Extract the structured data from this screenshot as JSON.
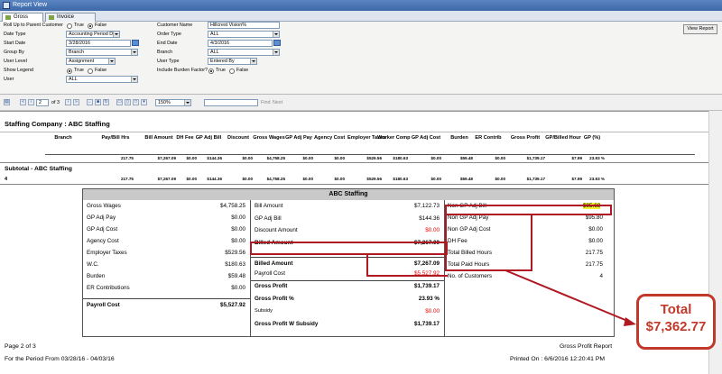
{
  "window": {
    "title": "Report View"
  },
  "tabs": [
    {
      "label": "Gross Profit"
    },
    {
      "label": "Invoice Register"
    }
  ],
  "filters": {
    "rollup_label": "Roll Up to Parent Customer",
    "rollup_true": "True",
    "rollup_false": "False",
    "date_type_label": "Date Type",
    "date_type_value": "Accounting Period Date",
    "start_date_label": "Start Date",
    "start_date_value": "3/28/2016",
    "group_by_label": "Group By",
    "group_by_value": "Branch",
    "user_level_label": "User Level",
    "user_level_value": "Assignment",
    "show_legend_label": "Show Legend",
    "show_legend_true": "True",
    "show_legend_false": "False",
    "user_label": "User",
    "user_value": "ALL",
    "customer_name_label": "Customer Name",
    "customer_name_value": "Hillcrest Vision%",
    "order_type_label": "Order Type",
    "order_type_value": "ALL",
    "end_date_label": "End Date",
    "end_date_value": "4/3/2016",
    "branch_label": "Branch",
    "branch_value": "ALL",
    "user_type_label": "User Type",
    "user_type_value": "Entered By",
    "burden_label": "Include Burden Factor?",
    "burden_true": "True",
    "burden_false": "False",
    "view_report": "View Report"
  },
  "toolbar": {
    "page_input": "2",
    "page_of": "of 3",
    "zoom": "150%",
    "find_label": "Find",
    "next_label": "Next"
  },
  "report": {
    "company_title": "Staffing Company : ABC Staffing",
    "columns": [
      "Branch",
      "Pay/Bill Hrs",
      "Bill Amount",
      "DH Fee",
      "GP Adj Bill",
      "Discount",
      "Gross Wages",
      "GP Adj Pay",
      "Agency Cost",
      "Employer Taxes",
      "Worker Comp",
      "GP Adj Cost",
      "Burden",
      "ER Contrib",
      "Gross Profit",
      "GP/Billed Hour",
      "GP (%)"
    ],
    "detail_row": [
      "",
      "217.75",
      "$7,267.09",
      "$0.00",
      "$144.36",
      "$0.00",
      "$4,758.25",
      "$0.00",
      "$0.00",
      "$529.56",
      "$180.63",
      "$0.00",
      "$59.48",
      "$0.00",
      "$1,739.17",
      "$7.99",
      "23.93 %"
    ],
    "subtotal_label": "Subtotal - ABC Staffing",
    "subtotal_index": "4",
    "subtotal_row": [
      "",
      "217.75",
      "$7,267.09",
      "$0.00",
      "$144.36",
      "$0.00",
      "$4,758.25",
      "$0.00",
      "$0.00",
      "$529.56",
      "$180.63",
      "$0.00",
      "$59.48",
      "$0.00",
      "$1,739.17",
      "$7.99",
      "23.93 %"
    ]
  },
  "summary": {
    "title": "ABC Staffing",
    "col1": [
      {
        "label": "Gross Wages",
        "value": "$4,758.25"
      },
      {
        "label": "GP Adj Pay",
        "value": "$0.00"
      },
      {
        "label": "GP Adj Cost",
        "value": "$0.00"
      },
      {
        "label": "Agency Cost",
        "value": "$0.00"
      },
      {
        "label": "Employer Taxes",
        "value": "$529.56"
      },
      {
        "label": "W.C.",
        "value": "$180.63"
      },
      {
        "label": "Burden",
        "value": "$59.48"
      },
      {
        "label": "ER Contributions",
        "value": "$0.00"
      }
    ],
    "payroll_cost_label": "Payroll Cost",
    "payroll_cost_value": "$5,527.92",
    "col2": [
      {
        "label": "Bill Amount",
        "value": "$7,122.73"
      },
      {
        "label": "GP Adj Bill",
        "value": "$144.36"
      },
      {
        "label": "Discount Amount",
        "value": "$0.00"
      },
      {
        "label": "Billed Amount",
        "value": "$7,267.09"
      }
    ],
    "col2b": [
      {
        "label": "Billed Amount",
        "value": "$7,267.09"
      },
      {
        "label": "Payroll Cost",
        "value": "$5,527.92"
      }
    ],
    "col2c": [
      {
        "label": "Gross Profit",
        "value": "$1,739.17"
      },
      {
        "label": "Gross Profit %",
        "value": "23.93 %"
      },
      {
        "label": "Subsidy",
        "value": "$0.00"
      },
      {
        "label": "Gross Profit W Subsidy",
        "value": "$1,739.17"
      }
    ],
    "col3": [
      {
        "label": "Non GP Adj Bill",
        "value": "$95.68"
      },
      {
        "label": "Non GP Adj Pay",
        "value": "$95.80"
      },
      {
        "label": "Non GP Adj Cost",
        "value": "$0.00"
      },
      {
        "label": "DH Fee",
        "value": "$0.00"
      },
      {
        "label": "Total Billed Hours",
        "value": "217.75"
      },
      {
        "label": "Total Paid Hours",
        "value": "217.75"
      },
      {
        "label": "No. of Customers",
        "value": "4"
      }
    ]
  },
  "footer": {
    "page": "Page 2 of 3",
    "period": "For the Period From 03/28/16 - 04/03/16",
    "report_name": "Gross Profit Report",
    "printed": "Printed On : 6/6/2016 12:20:41 PM"
  },
  "callout": {
    "line1": "Total",
    "line2": "$7,362.77"
  },
  "colors": {
    "highlight_red": "#b01822",
    "callout_red": "#c0392b",
    "value_highlight": "#f2f233"
  }
}
